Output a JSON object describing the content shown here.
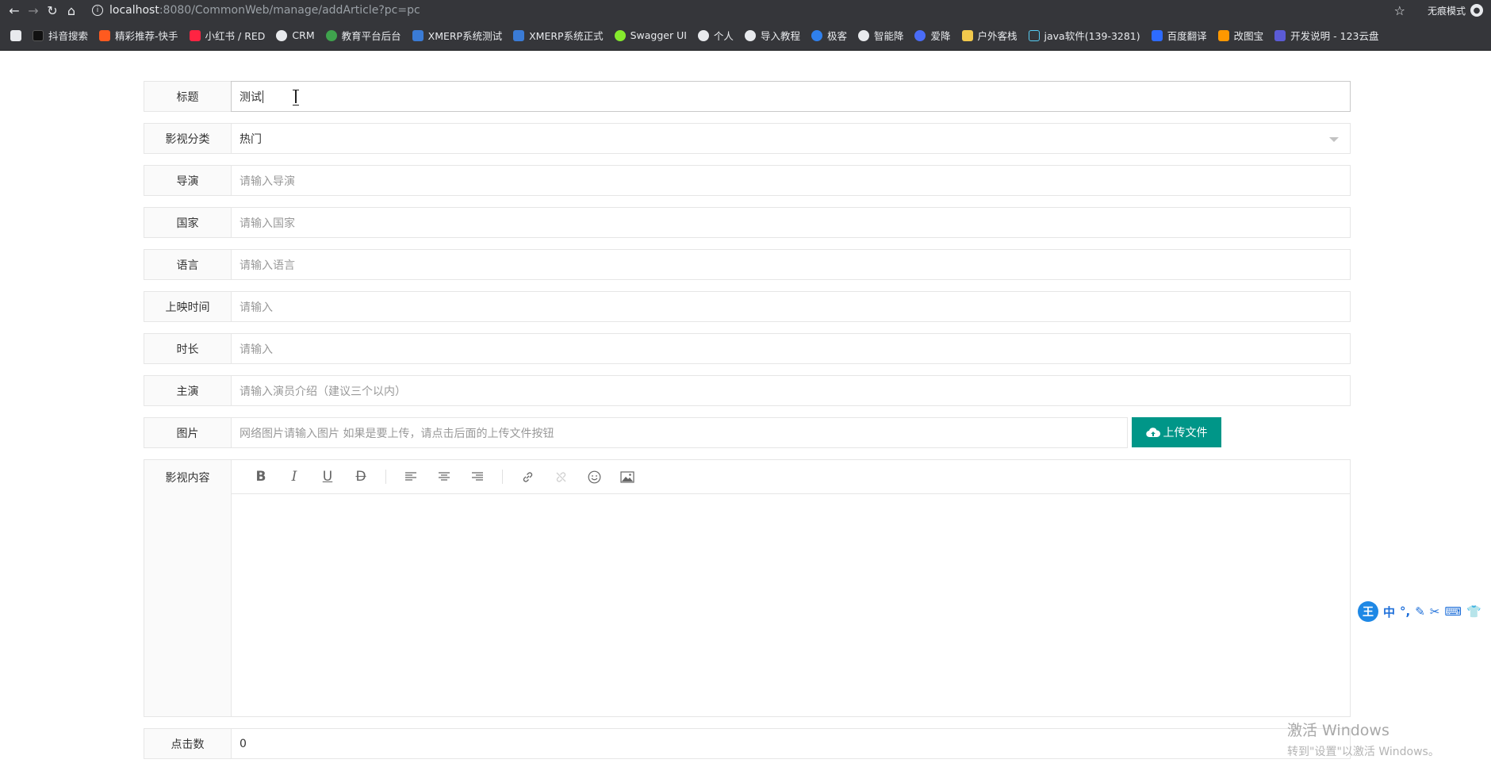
{
  "browser": {
    "url_host": "localhost",
    "url_rest": ":8080/CommonWeb/manage/addArticle?pc=pc",
    "incognito_label": "无痕模式",
    "bookmarks": [
      {
        "label": "抖音搜索",
        "color": "#111111"
      },
      {
        "label": "精彩推荐-快手",
        "color": "#ff5a1f"
      },
      {
        "label": "小红书 / RED",
        "color": "#ff2442"
      },
      {
        "label": "CRM",
        "color": "#e8eaed"
      },
      {
        "label": "教育平台后台",
        "color": "#3fa34d"
      },
      {
        "label": "XMERP系统测试",
        "color": "#3a7bd5"
      },
      {
        "label": "XMERP系统正式",
        "color": "#3a7bd5"
      },
      {
        "label": "Swagger UI",
        "color": "#85ea2d"
      },
      {
        "label": "个人",
        "color": "#e8eaed"
      },
      {
        "label": "导入教程",
        "color": "#e8eaed"
      },
      {
        "label": "极客",
        "color": "#2f80ed"
      },
      {
        "label": "智能降",
        "color": "#e8eaed"
      },
      {
        "label": "爱降",
        "color": "#4a6cf7"
      },
      {
        "label": "户外客栈",
        "color": "#f2c94c"
      },
      {
        "label": "java软件(139-3281)",
        "color": "#56ccf2"
      },
      {
        "label": "百度翻译",
        "color": "#2d6bff"
      },
      {
        "label": "改图宝",
        "color": "#ff9800"
      },
      {
        "label": "开发说明 - 123云盘",
        "color": "#5b5bd6"
      }
    ]
  },
  "form": {
    "title": {
      "label": "标题",
      "value": "测试"
    },
    "category": {
      "label": "影视分类",
      "value": "热门"
    },
    "director": {
      "label": "导演",
      "placeholder": "请输入导演"
    },
    "country": {
      "label": "国家",
      "placeholder": "请输入国家"
    },
    "language": {
      "label": "语言",
      "placeholder": "请输入语言"
    },
    "release": {
      "label": "上映时间",
      "placeholder": "请输入"
    },
    "duration": {
      "label": "时长",
      "placeholder": "请输入"
    },
    "cast": {
      "label": "主演",
      "placeholder": "请输入演员介绍（建议三个以内）"
    },
    "image": {
      "label": "图片",
      "placeholder": "网络图片请输入图片 如果是要上传，请点击后面的上传文件按钮",
      "upload_label": "上传文件"
    },
    "content": {
      "label": "影视内容"
    },
    "clicks": {
      "label": "点击数",
      "value": "0"
    }
  },
  "editor_tools": [
    "bold-icon",
    "italic-icon",
    "underline-icon",
    "strikethrough-icon",
    "align-left-icon",
    "align-center-icon",
    "align-right-icon",
    "link-icon",
    "unlink-icon",
    "emoji-icon",
    "image-icon"
  ],
  "ime": {
    "logo": "王",
    "mode": "中"
  },
  "watermark": {
    "line1": "激活 Windows",
    "line2": "转到\"设置\"以激活 Windows。"
  },
  "colors": {
    "accent": "#009688",
    "border": "#e6e6e6",
    "label_bg": "#fafafa",
    "chrome": "#35363a"
  }
}
